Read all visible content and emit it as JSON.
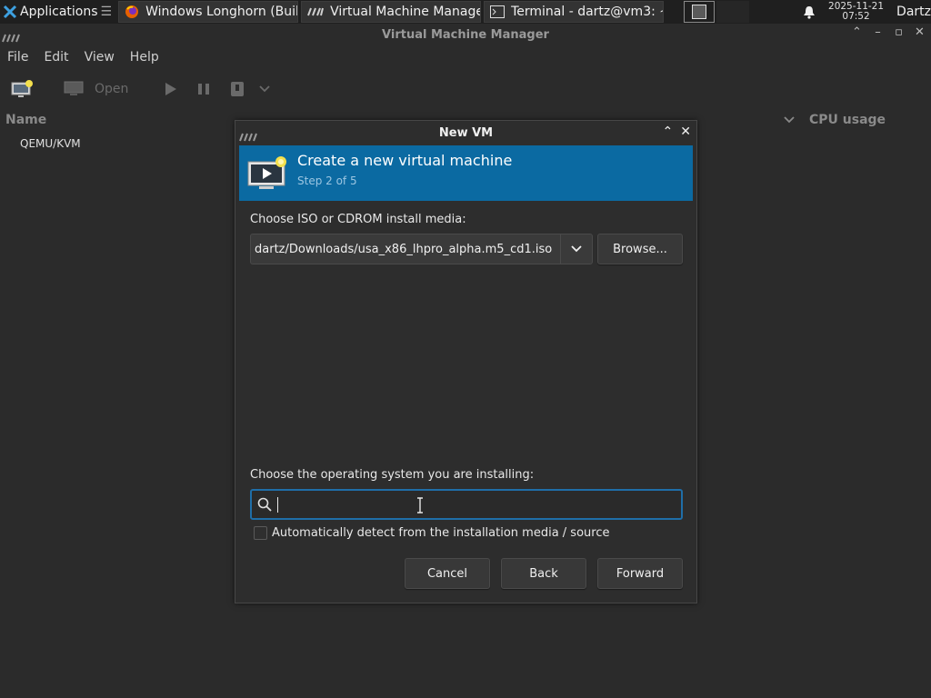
{
  "taskbar": {
    "apps_label": "Applications",
    "tasks": [
      {
        "icon": "firefox-icon",
        "label": "Windows Longhorn (Buil..."
      },
      {
        "icon": "virt-manager-icon",
        "label": "Virtual Machine Manager"
      },
      {
        "icon": "terminal-icon",
        "label": "Terminal - dartz@vm3: ~"
      }
    ],
    "clock_date": "2025-11-21",
    "clock_time": "07:52",
    "user": "Dartz"
  },
  "window": {
    "title": "Virtual Machine Manager",
    "menu": [
      "File",
      "Edit",
      "View",
      "Help"
    ],
    "toolbar": {
      "open_label": "Open"
    },
    "list": {
      "col_name": "Name",
      "col_cpu": "CPU usage",
      "rows": [
        "QEMU/KVM"
      ]
    }
  },
  "dialog": {
    "title": "New VM",
    "banner_title": "Create a new virtual machine",
    "banner_step": "Step 2 of 5",
    "iso_label": "Choose ISO or CDROM install media:",
    "iso_value": "dartz/Downloads/usa_x86_lhpro_alpha.m5_cd1.iso",
    "browse_label": "Browse...",
    "os_label": "Choose the operating system you are installing:",
    "os_search_value": "",
    "autodetect_label": "Automatically detect from the installation media / source",
    "autodetect_checked": false,
    "cancel_label": "Cancel",
    "back_label": "Back",
    "forward_label": "Forward"
  },
  "colors": {
    "banner": "#0b6aa2",
    "focus": "#1f6ea8"
  }
}
